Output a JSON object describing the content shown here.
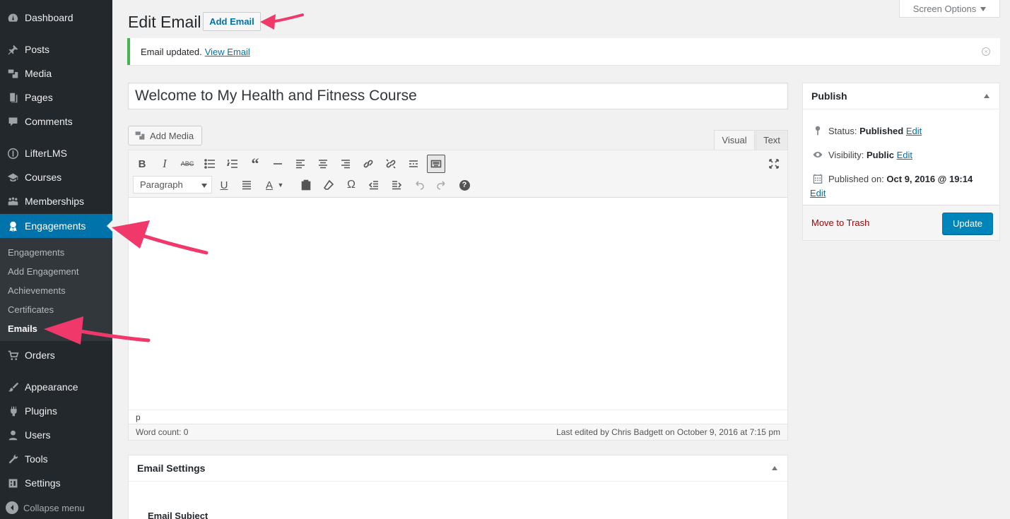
{
  "sidebar": {
    "items": [
      {
        "label": "Dashboard",
        "icon": "dashboard-icon"
      },
      {
        "label": "Posts",
        "icon": "pin-icon"
      },
      {
        "label": "Media",
        "icon": "media-icon"
      },
      {
        "label": "Pages",
        "icon": "pages-icon"
      },
      {
        "label": "Comments",
        "icon": "comment-icon"
      },
      {
        "label": "LifterLMS",
        "icon": "lifterlms-icon"
      },
      {
        "label": "Courses",
        "icon": "graduation-cap-icon"
      },
      {
        "label": "Memberships",
        "icon": "groups-icon"
      },
      {
        "label": "Engagements",
        "icon": "award-icon"
      },
      {
        "label": "Orders",
        "icon": "cart-icon"
      },
      {
        "label": "Appearance",
        "icon": "paintbrush-icon"
      },
      {
        "label": "Plugins",
        "icon": "plugin-icon"
      },
      {
        "label": "Users",
        "icon": "users-icon"
      },
      {
        "label": "Tools",
        "icon": "wrench-icon"
      },
      {
        "label": "Settings",
        "icon": "settings-icon"
      }
    ],
    "submenu": [
      "Engagements",
      "Add Engagement",
      "Achievements",
      "Certificates",
      "Emails"
    ],
    "collapse_label": "Collapse menu"
  },
  "header": {
    "title": "Edit Email",
    "add_button": "Add Email",
    "screen_options": "Screen Options"
  },
  "notice": {
    "text": "Email updated.",
    "link": "View Email"
  },
  "post": {
    "title": "Welcome to My Health and Fitness Course"
  },
  "editor": {
    "add_media": "Add Media",
    "tab_visual": "Visual",
    "tab_text": "Text",
    "format": "Paragraph",
    "path": "p",
    "word_count": "Word count: 0",
    "last_edited": "Last edited by Chris Badgett on October 9, 2016 at 7:15 pm"
  },
  "publish": {
    "title": "Publish",
    "status_label": "Status:",
    "status_value": "Published",
    "visibility_label": "Visibility:",
    "visibility_value": "Public",
    "published_label": "Published on:",
    "published_value": "Oct 9, 2016 @ 19:14",
    "edit": "Edit",
    "trash": "Move to Trash",
    "update": "Update"
  },
  "email_settings": {
    "title": "Email Settings",
    "subject_label": "Email Subject"
  },
  "colors": {
    "sidebar_bg": "#23282d",
    "accent": "#0073aa",
    "annotation_arrow": "#f0386b"
  }
}
